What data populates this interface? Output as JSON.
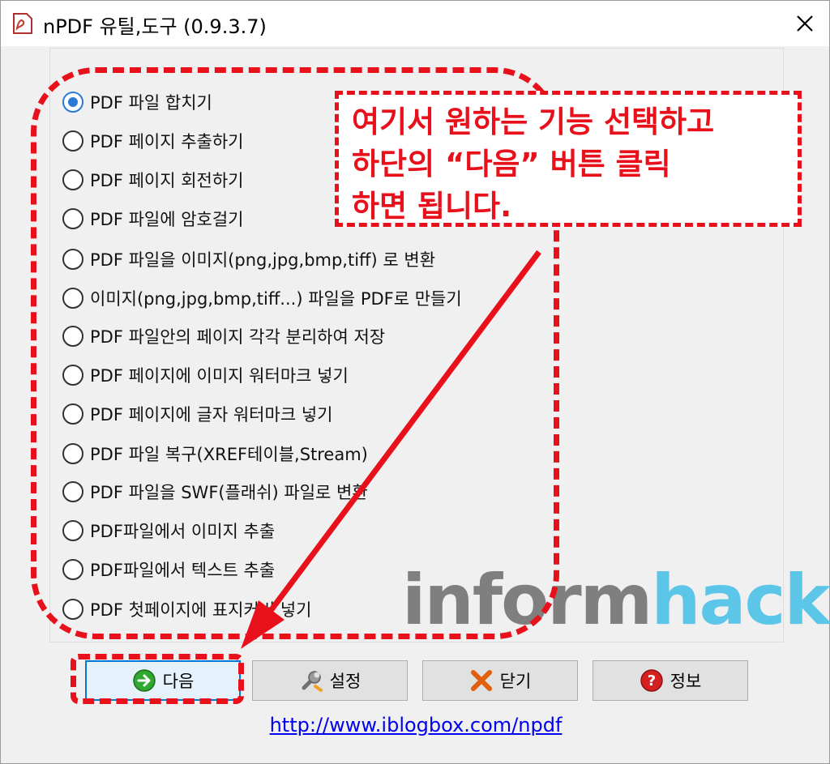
{
  "window": {
    "title": "nPDF 유틸,도구 (0.9.3.7)",
    "icons": {
      "app": "pdf-app-icon",
      "close": "close-icon"
    }
  },
  "options": [
    {
      "label": "PDF 파일 합치기",
      "checked": true
    },
    {
      "label": "PDF 페이지 추출하기",
      "checked": false
    },
    {
      "label": "PDF 페이지 회전하기",
      "checked": false
    },
    {
      "label": "PDF 파일에 암호걸기",
      "checked": false
    },
    {
      "label": "PDF 파일을 이미지(png,jpg,bmp,tiff) 로 변환",
      "checked": false
    },
    {
      "label": "이미지(png,jpg,bmp,tiff...) 파일을 PDF로 만들기",
      "checked": false
    },
    {
      "label": "PDF 파일안의 페이지 각각 분리하여 저장",
      "checked": false
    },
    {
      "label": "PDF 페이지에 이미지 워터마크 넣기",
      "checked": false
    },
    {
      "label": "PDF 페이지에 글자 워터마크 넣기",
      "checked": false
    },
    {
      "label": "PDF 파일 복구(XREF테이블,Stream)",
      "checked": false
    },
    {
      "label": "PDF 파일을 SWF(플래쉬) 파일로 변환",
      "checked": false
    },
    {
      "label": "PDF파일에서 이미지 추출",
      "checked": false
    },
    {
      "label": "PDF파일에서 텍스트 추출",
      "checked": false
    },
    {
      "label": "PDF 첫페이지에 표지커버 넣기",
      "checked": false
    }
  ],
  "callout": {
    "text": "여기서 원하는 기능 선택하고\n하단의 “다음” 버튼 클릭\n하면 됩니다."
  },
  "watermark": {
    "part1": "inform",
    "part2": "hack"
  },
  "buttons": {
    "next": {
      "label": "다음",
      "icon": "green-arrow-icon"
    },
    "settings": {
      "label": "설정",
      "icon": "wrench-icon"
    },
    "close": {
      "label": "닫기",
      "icon": "red-x-icon"
    },
    "info": {
      "label": "정보",
      "icon": "help-icon"
    }
  },
  "link": {
    "text": "http://www.iblogbox.com/npdf"
  },
  "colors": {
    "annotation": "#e8101a",
    "radio_selected": "#2a7ad8",
    "link": "#0000ee"
  }
}
